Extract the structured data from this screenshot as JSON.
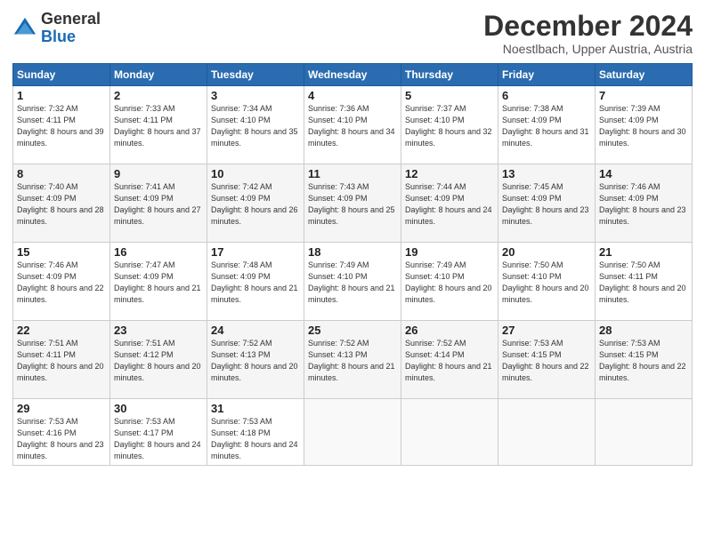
{
  "header": {
    "logo_general": "General",
    "logo_blue": "Blue",
    "month_title": "December 2024",
    "location": "Noestlbach, Upper Austria, Austria"
  },
  "days_of_week": [
    "Sunday",
    "Monday",
    "Tuesday",
    "Wednesday",
    "Thursday",
    "Friday",
    "Saturday"
  ],
  "weeks": [
    [
      {
        "day": "1",
        "sunrise": "7:32 AM",
        "sunset": "4:11 PM",
        "daylight": "8 hours and 39 minutes."
      },
      {
        "day": "2",
        "sunrise": "7:33 AM",
        "sunset": "4:11 PM",
        "daylight": "8 hours and 37 minutes."
      },
      {
        "day": "3",
        "sunrise": "7:34 AM",
        "sunset": "4:10 PM",
        "daylight": "8 hours and 35 minutes."
      },
      {
        "day": "4",
        "sunrise": "7:36 AM",
        "sunset": "4:10 PM",
        "daylight": "8 hours and 34 minutes."
      },
      {
        "day": "5",
        "sunrise": "7:37 AM",
        "sunset": "4:10 PM",
        "daylight": "8 hours and 32 minutes."
      },
      {
        "day": "6",
        "sunrise": "7:38 AM",
        "sunset": "4:09 PM",
        "daylight": "8 hours and 31 minutes."
      },
      {
        "day": "7",
        "sunrise": "7:39 AM",
        "sunset": "4:09 PM",
        "daylight": "8 hours and 30 minutes."
      }
    ],
    [
      {
        "day": "8",
        "sunrise": "7:40 AM",
        "sunset": "4:09 PM",
        "daylight": "8 hours and 28 minutes."
      },
      {
        "day": "9",
        "sunrise": "7:41 AM",
        "sunset": "4:09 PM",
        "daylight": "8 hours and 27 minutes."
      },
      {
        "day": "10",
        "sunrise": "7:42 AM",
        "sunset": "4:09 PM",
        "daylight": "8 hours and 26 minutes."
      },
      {
        "day": "11",
        "sunrise": "7:43 AM",
        "sunset": "4:09 PM",
        "daylight": "8 hours and 25 minutes."
      },
      {
        "day": "12",
        "sunrise": "7:44 AM",
        "sunset": "4:09 PM",
        "daylight": "8 hours and 24 minutes."
      },
      {
        "day": "13",
        "sunrise": "7:45 AM",
        "sunset": "4:09 PM",
        "daylight": "8 hours and 23 minutes."
      },
      {
        "day": "14",
        "sunrise": "7:46 AM",
        "sunset": "4:09 PM",
        "daylight": "8 hours and 23 minutes."
      }
    ],
    [
      {
        "day": "15",
        "sunrise": "7:46 AM",
        "sunset": "4:09 PM",
        "daylight": "8 hours and 22 minutes."
      },
      {
        "day": "16",
        "sunrise": "7:47 AM",
        "sunset": "4:09 PM",
        "daylight": "8 hours and 21 minutes."
      },
      {
        "day": "17",
        "sunrise": "7:48 AM",
        "sunset": "4:09 PM",
        "daylight": "8 hours and 21 minutes."
      },
      {
        "day": "18",
        "sunrise": "7:49 AM",
        "sunset": "4:10 PM",
        "daylight": "8 hours and 21 minutes."
      },
      {
        "day": "19",
        "sunrise": "7:49 AM",
        "sunset": "4:10 PM",
        "daylight": "8 hours and 20 minutes."
      },
      {
        "day": "20",
        "sunrise": "7:50 AM",
        "sunset": "4:10 PM",
        "daylight": "8 hours and 20 minutes."
      },
      {
        "day": "21",
        "sunrise": "7:50 AM",
        "sunset": "4:11 PM",
        "daylight": "8 hours and 20 minutes."
      }
    ],
    [
      {
        "day": "22",
        "sunrise": "7:51 AM",
        "sunset": "4:11 PM",
        "daylight": "8 hours and 20 minutes."
      },
      {
        "day": "23",
        "sunrise": "7:51 AM",
        "sunset": "4:12 PM",
        "daylight": "8 hours and 20 minutes."
      },
      {
        "day": "24",
        "sunrise": "7:52 AM",
        "sunset": "4:13 PM",
        "daylight": "8 hours and 20 minutes."
      },
      {
        "day": "25",
        "sunrise": "7:52 AM",
        "sunset": "4:13 PM",
        "daylight": "8 hours and 21 minutes."
      },
      {
        "day": "26",
        "sunrise": "7:52 AM",
        "sunset": "4:14 PM",
        "daylight": "8 hours and 21 minutes."
      },
      {
        "day": "27",
        "sunrise": "7:53 AM",
        "sunset": "4:15 PM",
        "daylight": "8 hours and 22 minutes."
      },
      {
        "day": "28",
        "sunrise": "7:53 AM",
        "sunset": "4:15 PM",
        "daylight": "8 hours and 22 minutes."
      }
    ],
    [
      {
        "day": "29",
        "sunrise": "7:53 AM",
        "sunset": "4:16 PM",
        "daylight": "8 hours and 23 minutes."
      },
      {
        "day": "30",
        "sunrise": "7:53 AM",
        "sunset": "4:17 PM",
        "daylight": "8 hours and 24 minutes."
      },
      {
        "day": "31",
        "sunrise": "7:53 AM",
        "sunset": "4:18 PM",
        "daylight": "8 hours and 24 minutes."
      },
      null,
      null,
      null,
      null
    ]
  ],
  "labels": {
    "sunrise": "Sunrise:",
    "sunset": "Sunset:",
    "daylight": "Daylight:"
  }
}
